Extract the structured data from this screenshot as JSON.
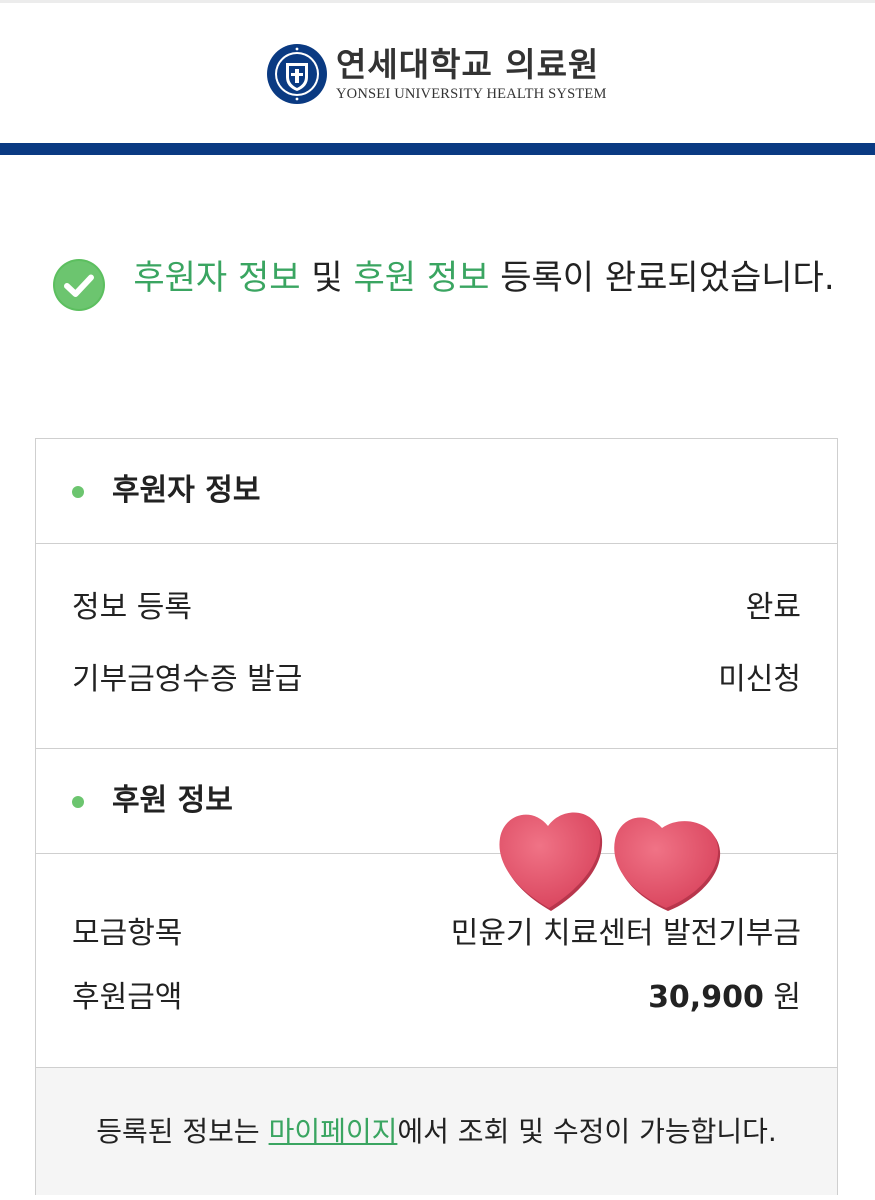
{
  "header": {
    "logo_ko": "연세대학교 의료원",
    "logo_en": "YONSEI UNIVERSITY HEALTH SYSTEM",
    "seal_text": "YONSEI UNIVERSITY"
  },
  "message": {
    "part1": "후원자 정보",
    "part2": " 및 ",
    "part3": "후원 정보",
    "part4": " 등록이 완료되었습니다."
  },
  "donor_section": {
    "title": "후원자 정보",
    "rows": [
      {
        "label": "정보 등록",
        "value": "완료"
      },
      {
        "label": "기부금영수증 발급",
        "value": "미신청"
      }
    ]
  },
  "donation_section": {
    "title": "후원 정보",
    "rows": [
      {
        "label": "모금항목",
        "value": "민윤기 치료센터 발전기부금"
      },
      {
        "label": "후원금액",
        "amount": "30,900",
        "unit": "원"
      }
    ]
  },
  "footer": {
    "text_before": "등록된 정보는 ",
    "link": "마이페이지",
    "text_after": "에서 조회 및 수정이 가능합니다."
  },
  "colors": {
    "brand_navy": "#0a3a82",
    "accent_green": "#3aa561",
    "dot_green": "#6cc56f",
    "heart_pink": "#e8566e"
  },
  "icons": [
    "university-seal-icon",
    "check-circle-icon",
    "bullet-dot-icon",
    "heart-icon"
  ]
}
